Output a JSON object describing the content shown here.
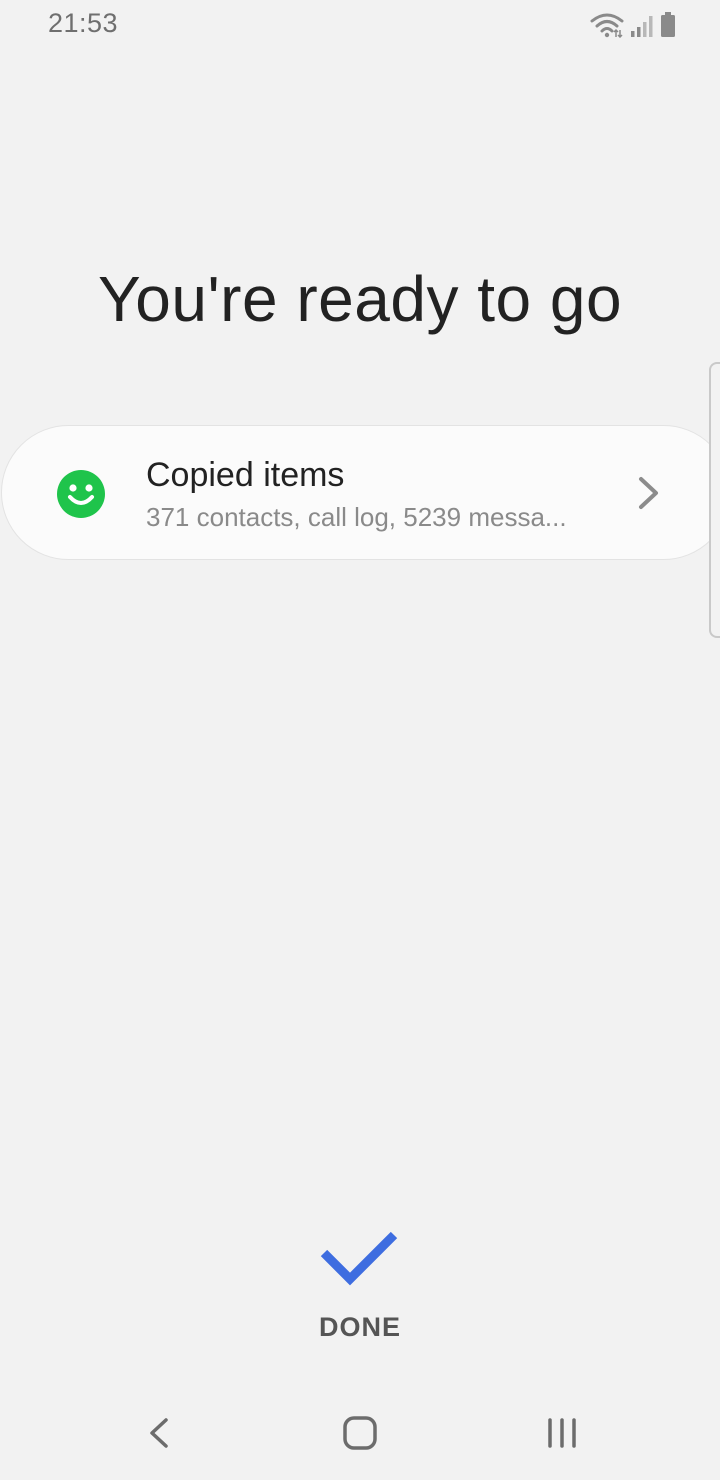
{
  "status_bar": {
    "time": "21:53",
    "icons": [
      "wifi-icon",
      "signal-icon",
      "battery-icon"
    ]
  },
  "main": {
    "title": "You're ready to go"
  },
  "card": {
    "icon": "smiley-icon",
    "title": "Copied items",
    "subtitle": "371 contacts, call log, 5239 messa..."
  },
  "done": {
    "icon": "checkmark-icon",
    "label": "DONE"
  },
  "nav_bar": {
    "buttons": [
      "back-icon",
      "home-icon",
      "recents-icon"
    ]
  },
  "colors": {
    "background": "#f2f2f2",
    "accent_green": "#1fc44b",
    "accent_blue": "#3e6de0",
    "title_text": "#222222",
    "subtitle_text": "#8a8a8a"
  }
}
